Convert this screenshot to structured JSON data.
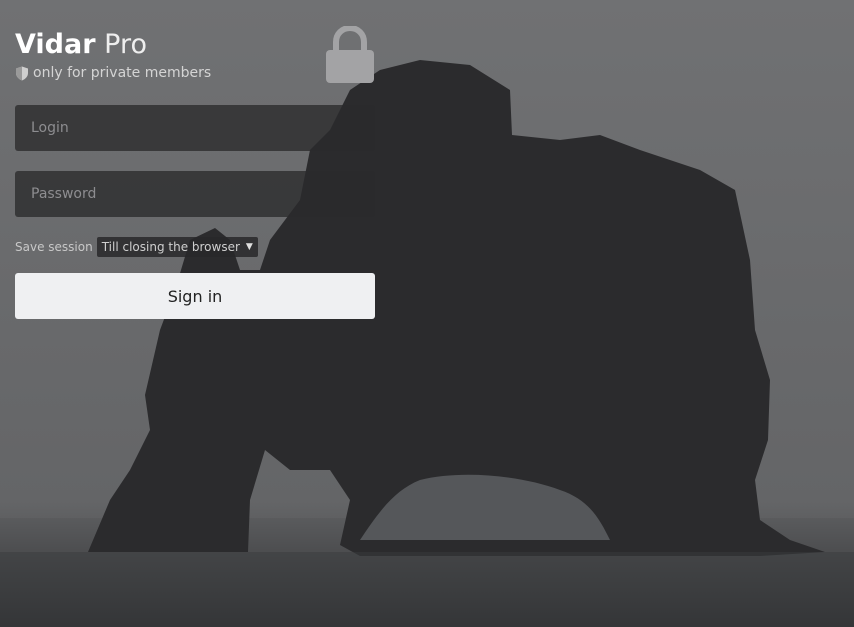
{
  "brand": {
    "name_bold": "Vidar",
    "name_light": "Pro",
    "tagline": "only for private members"
  },
  "form": {
    "login_placeholder": "Login",
    "password_placeholder": "Password",
    "session_label": "Save session",
    "session_value": "Till closing the browser",
    "signin_label": "Sign in"
  },
  "icons": {
    "tagline_icon": "shield-icon",
    "lock": "lock-icon",
    "select_arrow": "chevron-down-icon"
  },
  "colors": {
    "background": "#6b6c6e",
    "field_bg": "#2a2a2c",
    "button_bg": "#eff0f2",
    "text": "#ffffff"
  }
}
